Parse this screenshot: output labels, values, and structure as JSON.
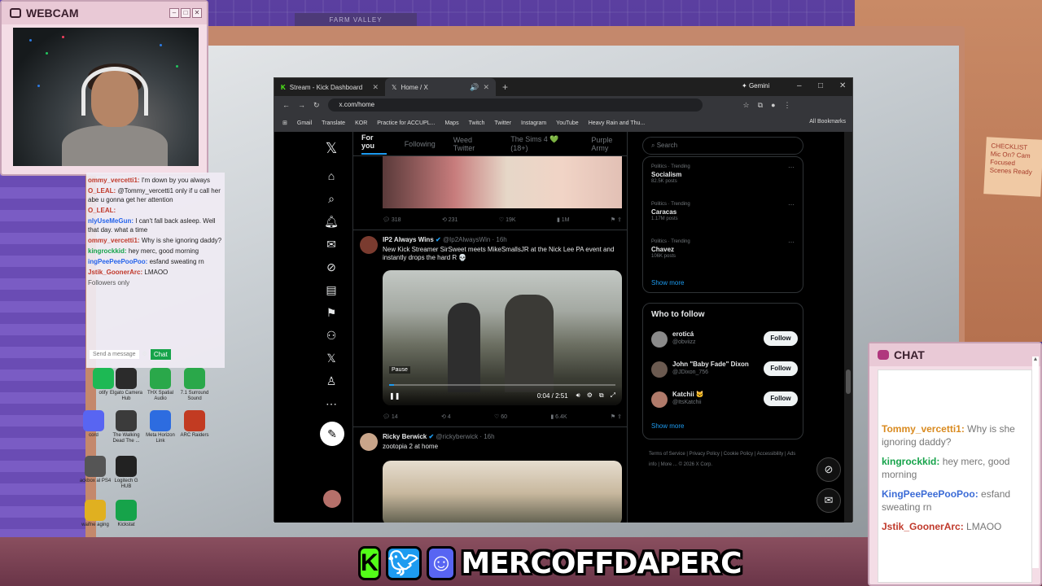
{
  "overlay": {
    "webcam_title": "WEBCAM",
    "chat_title": "CHAT",
    "handle": "MERCOFFDAPERC",
    "left_chat": [
      {
        "user": "ommy_vercetti1:",
        "text": "I'm down by you always"
      },
      {
        "user": "O_LEAL:",
        "text": "@Tommy_vercetti1 only if u call her abe u gonna get her attention"
      },
      {
        "user": "O_LEAL:",
        "text": ""
      },
      {
        "user": "nlyUseMeGun:",
        "text": "I can't fall back asleep. Well that day. what a time"
      },
      {
        "user": "ommy_vercetti1:",
        "text": "Why is she ignoring daddy?"
      },
      {
        "user": "kingrockkid:",
        "text": "hey merc, good morning"
      },
      {
        "user": "ingPeePeePooPoo:",
        "text": "esfand sweating rn"
      },
      {
        "user": "Jstik_GoonerArc:",
        "text": "LMAOO"
      }
    ],
    "left_chat_followers": "Followers only",
    "left_chat_send": "Send a message",
    "left_chat_button": "Chat",
    "right_chat": [
      {
        "user": "Tommy_vercetti1:",
        "text": "Why is she ignoring daddy?",
        "cls": "o"
      },
      {
        "user": "kingrockkid:",
        "text": "hey merc, good morning",
        "cls": "g"
      },
      {
        "user": "KingPeePeePooPoo:",
        "text": "esfand sweating rn",
        "cls": "bl"
      },
      {
        "user": "Jstik_GoonerArc:",
        "text": "LMAOO",
        "cls": "r"
      }
    ],
    "sticky_note": "CHECKLIST Mic On? Cam Focused Scenes Ready",
    "sign_text": "FARM VALLEY"
  },
  "desktop_icons": [
    {
      "label": "otify",
      "color": "#1db954"
    },
    {
      "label": "Elgato Camera Hub",
      "color": "#2b2b2b"
    },
    {
      "label": "THX Spatial Audio",
      "color": "#2aa84a"
    },
    {
      "label": "7.1 Surround Sound",
      "color": "#2aa84a"
    },
    {
      "label": "cord",
      "color": "#5865f2"
    },
    {
      "label": "The Walking Dead The ...",
      "color": "#3b3b3b"
    },
    {
      "label": "Meta Horizon Link",
      "color": "#2d6ce0"
    },
    {
      "label": "ARC Raiders",
      "color": "#c23b22"
    },
    {
      "label": "ackbox al PS4",
      "color": "#555"
    },
    {
      "label": "Logitech G HUB",
      "color": "#222"
    },
    {
      "label": "waifne aging",
      "color": "#e0b020"
    },
    {
      "label": "Kickstat",
      "color": "#16a34a"
    }
  ],
  "browser": {
    "tabs": [
      {
        "label": "Stream - Kick Dashboard",
        "active": false
      },
      {
        "label": "Home / X",
        "active": true
      }
    ],
    "gemini": "Gemini",
    "url": "x.com/home",
    "bookmarks": [
      "Gmail",
      "Translate",
      "KOR",
      "Practice for ACCUPL...",
      "Maps",
      "Twitch",
      "Twitter",
      "Instagram",
      "YouTube",
      "Heavy Rain and Thu..."
    ],
    "all_bookmarks": "All Bookmarks"
  },
  "x": {
    "feed_tabs": [
      "For you",
      "Following",
      "Weed Twitter",
      "The Sims 4 💚 (18+)",
      "Purple Army"
    ],
    "post0_actions": [
      "318",
      "231",
      "19K",
      "1M"
    ],
    "posts": [
      {
        "name": "IP2 Always Wins",
        "handle": "@Ip2AlwaysWin · 16h",
        "text": "New Kick Streamer SirSweet meets MikeSmallsJR at the Nick Lee PA event and instantly drops the hard R 💀",
        "video_time": "0:04 / 2:51",
        "pause_label": "Pause",
        "actions": [
          "14",
          "4",
          "60",
          "6.4K"
        ]
      },
      {
        "name": "Ricky Berwick",
        "handle": "@rickyberwick · 16h",
        "text": "zootopia 2 at home"
      }
    ],
    "search_placeholder": "Search",
    "trends": [
      {
        "category": "Politics · Trending",
        "title": "Socialism",
        "posts": "82.5K posts"
      },
      {
        "category": "Politics · Trending",
        "title": "Caracas",
        "posts": "1.17M posts"
      },
      {
        "category": "Politics · Trending",
        "title": "Chavez",
        "posts": "106K posts"
      }
    ],
    "show_more": "Show more",
    "who_to_follow": "Who to follow",
    "suggestions": [
      {
        "name": "eroticá",
        "handle": "@obviizz",
        "button": "Follow"
      },
      {
        "name": "John \"Baby Fade\" Dixon",
        "handle": "@JDixon_756",
        "button": "Follow"
      },
      {
        "name": "Katchii 🐱",
        "handle": "@ItsKatchii",
        "button": "Follow"
      }
    ],
    "footer": "Terms of Service | Privacy Policy | Cookie Policy | Accessibility | Ads info | More ... © 2026 X Corp."
  }
}
